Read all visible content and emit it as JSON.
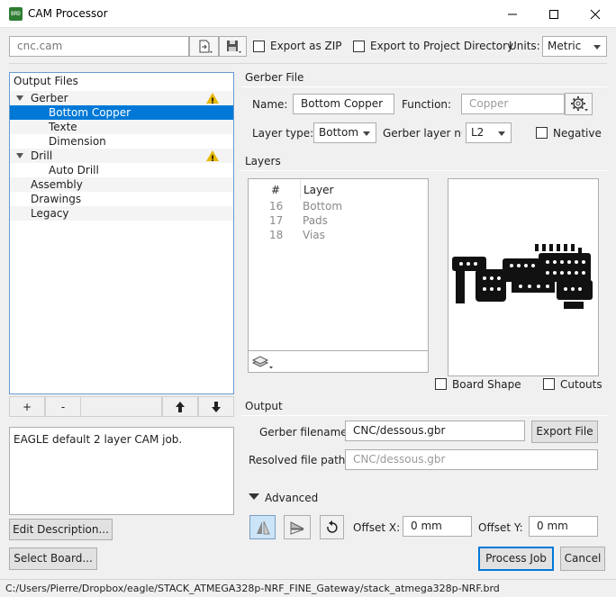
{
  "window": {
    "title": "CAM Processor",
    "app_icon_text": "BRD"
  },
  "toolbar": {
    "cam_file": "cnc.cam",
    "export_zip_label": "Export as ZIP",
    "export_zip_checked": false,
    "export_project_dir_label": "Export to Project Directory",
    "export_project_dir_checked": false,
    "units_label": "Units:",
    "units_value": "Metric"
  },
  "output_files": {
    "header": "Output Files",
    "items": [
      {
        "label": "Gerber",
        "level": 0,
        "expanded": true,
        "warning": true
      },
      {
        "label": "Bottom Copper",
        "level": 1,
        "selected": true
      },
      {
        "label": "Texte",
        "level": 1
      },
      {
        "label": "Dimension",
        "level": 1
      },
      {
        "label": "Drill",
        "level": 0,
        "expanded": true,
        "warning": true
      },
      {
        "label": "Auto Drill",
        "level": 1
      },
      {
        "label": "Assembly",
        "level": 0
      },
      {
        "label": "Drawings",
        "level": 0
      },
      {
        "label": "Legacy",
        "level": 0
      }
    ],
    "add_label": "+",
    "remove_label": "-"
  },
  "description": {
    "text": "EAGLE default 2 layer CAM job.",
    "edit_button": "Edit Description..."
  },
  "select_board_button": "Select Board...",
  "gerber_file": {
    "group_label": "Gerber File",
    "name_label": "Name:",
    "name_value": "Bottom Copper",
    "function_label": "Function:",
    "function_value": "Copper",
    "layer_type_label": "Layer type:",
    "layer_type_value": "Bottom",
    "gerber_layer_label": "Gerber layer nur",
    "gerber_layer_value": "L2",
    "negative_label": "Negative",
    "negative_checked": false
  },
  "layers": {
    "group_label": "Layers",
    "col_num": "#",
    "col_layer": "Layer",
    "rows": [
      {
        "num": "16",
        "name": "Bottom"
      },
      {
        "num": "17",
        "name": "Pads"
      },
      {
        "num": "18",
        "name": "Vias"
      }
    ],
    "board_shape_label": "Board Shape",
    "board_shape_checked": false,
    "cutouts_label": "Cutouts",
    "cutouts_checked": false
  },
  "output": {
    "group_label": "Output",
    "gerber_filename_label": "Gerber filename:",
    "gerber_filename_value": "CNC/dessous.gbr",
    "export_file_button": "Export File",
    "resolved_path_label": "Resolved file path:",
    "resolved_path_value": "CNC/dessous.gbr"
  },
  "advanced": {
    "label": "Advanced",
    "offset_x_label": "Offset X:",
    "offset_x_value": "0 mm",
    "offset_y_label": "Offset Y:",
    "offset_y_value": "0 mm"
  },
  "actions": {
    "process_job": "Process Job",
    "cancel": "Cancel"
  },
  "status": {
    "path": "C:/Users/Pierre/Dropbox/eagle/STACK_ATMEGA328p-NRF_FINE_Gateway/stack_atmega328p-NRF.brd"
  },
  "colors": {
    "accent": "#0078d7",
    "warning": "#e6b800"
  }
}
